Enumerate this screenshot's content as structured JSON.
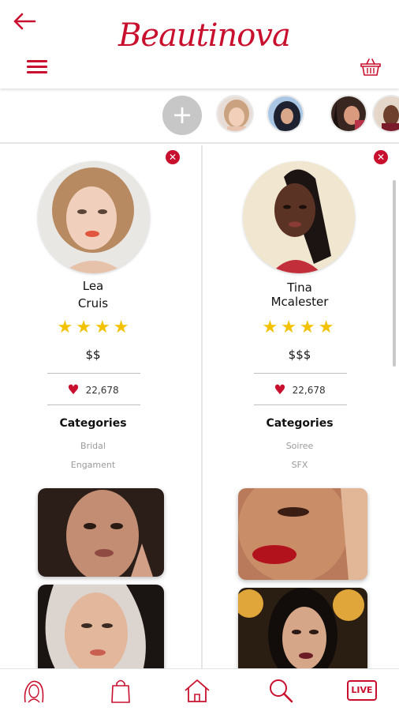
{
  "header": {
    "logo_text": "Beautinova",
    "back_icon": "arrow-left-icon",
    "menu_icon": "hamburger-menu-icon",
    "cart_icon": "basket-icon"
  },
  "stories": {
    "add_label": "+"
  },
  "artists": [
    {
      "first_name": "Lea",
      "last_name": "Cruis",
      "rating": 4,
      "stars": "★★★★",
      "price": "$$",
      "likes": "22,678",
      "categories_title": "Categories",
      "categories": [
        "Bridal",
        "Engament"
      ]
    },
    {
      "first_name": "Tina",
      "last_name": "Mcalester",
      "rating": 4,
      "stars": "★★★★",
      "price": "$$$",
      "likes": "22,678",
      "categories_title": "Categories",
      "categories": [
        "Soiree",
        "SFX"
      ]
    }
  ],
  "remove_label": "✕",
  "bottom_nav": {
    "items": [
      "profile-icon",
      "shopping-bag-icon",
      "home-icon",
      "search-icon",
      "live-icon"
    ],
    "live_label": "LIVE"
  },
  "colors": {
    "brand": "#c8102e",
    "star": "#f2c200"
  }
}
